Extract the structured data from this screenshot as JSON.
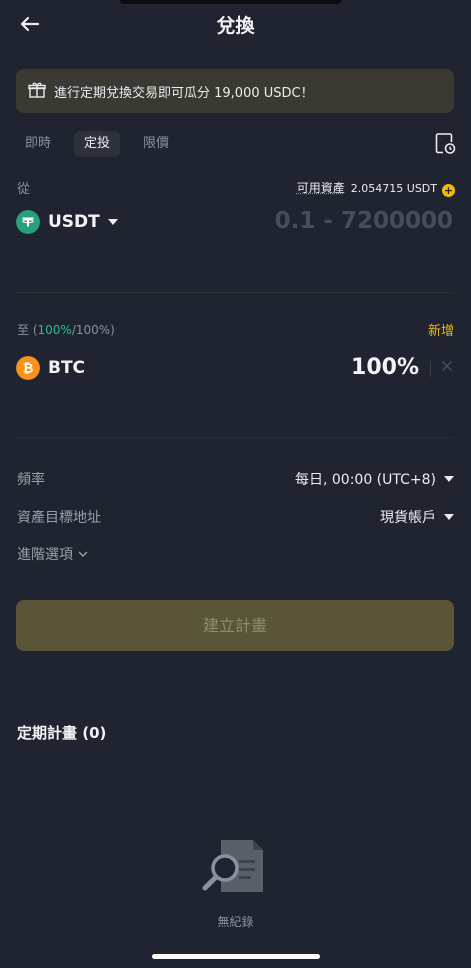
{
  "header": {
    "title": "兌換"
  },
  "banner": {
    "text": "進行定期兌換交易即可瓜分 19,000 USDC！"
  },
  "tabs": [
    {
      "label": "即時"
    },
    {
      "label": "定投"
    },
    {
      "label": "限價"
    }
  ],
  "from": {
    "label": "從",
    "available_label": "可用資產",
    "available_value": "2.054715 USDT",
    "coin": "USDT",
    "amount_placeholder": "0.1 - 7200000"
  },
  "to": {
    "label_prefix": "至 (",
    "label_pct": "100%",
    "label_suffix": "/100%)",
    "add_label": "新增",
    "coin": "BTC",
    "percent": "100%"
  },
  "settings": {
    "frequency_label": "頻率",
    "frequency_value": "每日, 00:00 (UTC+8)",
    "target_label": "資產目標地址",
    "target_value": "現貨帳戶",
    "advanced_label": "進階選項"
  },
  "create_button": "建立計畫",
  "plans": {
    "title": "定期計畫 (0)",
    "empty_text": "無紀錄"
  },
  "colors": {
    "accent": "#f0b90b",
    "green": "#2ebd85",
    "usdt": "#26a17b",
    "btc": "#f7931a"
  }
}
